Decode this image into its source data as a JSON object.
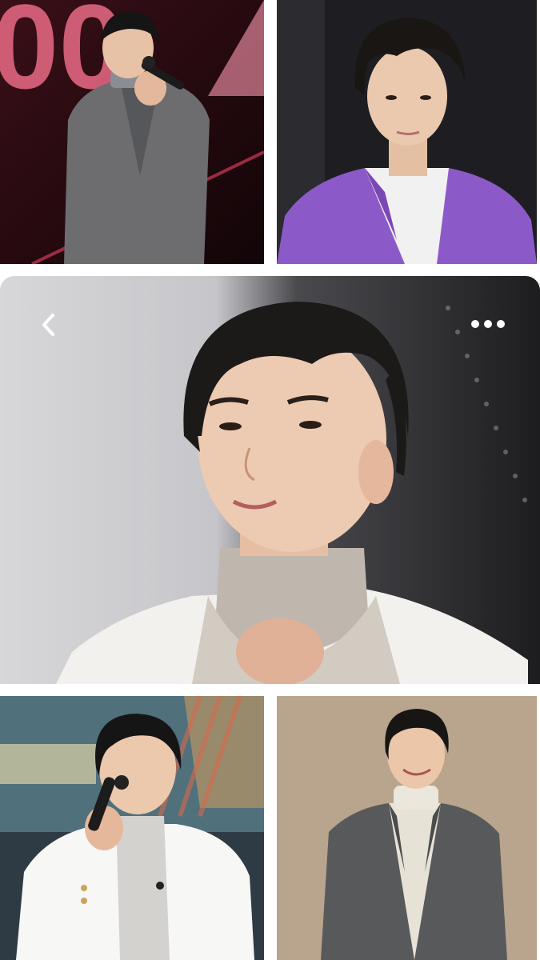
{
  "screen": {
    "type": "photo-gallery-viewer"
  },
  "toolbar": {
    "back_icon": "chevron-left-icon",
    "more_icon": "more-horizontal-icon"
  },
  "photos": [
    {
      "id": "photo-top-left",
      "subject": "man in grey tweed coat singing into microphone on stage",
      "background": "#2a1016"
    },
    {
      "id": "photo-top-right",
      "subject": "man in purple blazer and white shirt",
      "background": "#1f1f22"
    },
    {
      "id": "photo-featured",
      "subject": "close-up of man in white blazer and grey turtleneck",
      "background": "#c9c9cc"
    },
    {
      "id": "photo-bottom-left",
      "subject": "man in white blazer speaking into microphone",
      "background": "#3b4a55"
    },
    {
      "id": "photo-bottom-right",
      "subject": "man in grey coat and cream turtleneck smiling",
      "background": "#b9a58f"
    }
  ],
  "colors": {
    "page_background": "#ffffff",
    "overlay_icon": "#ffffff"
  }
}
